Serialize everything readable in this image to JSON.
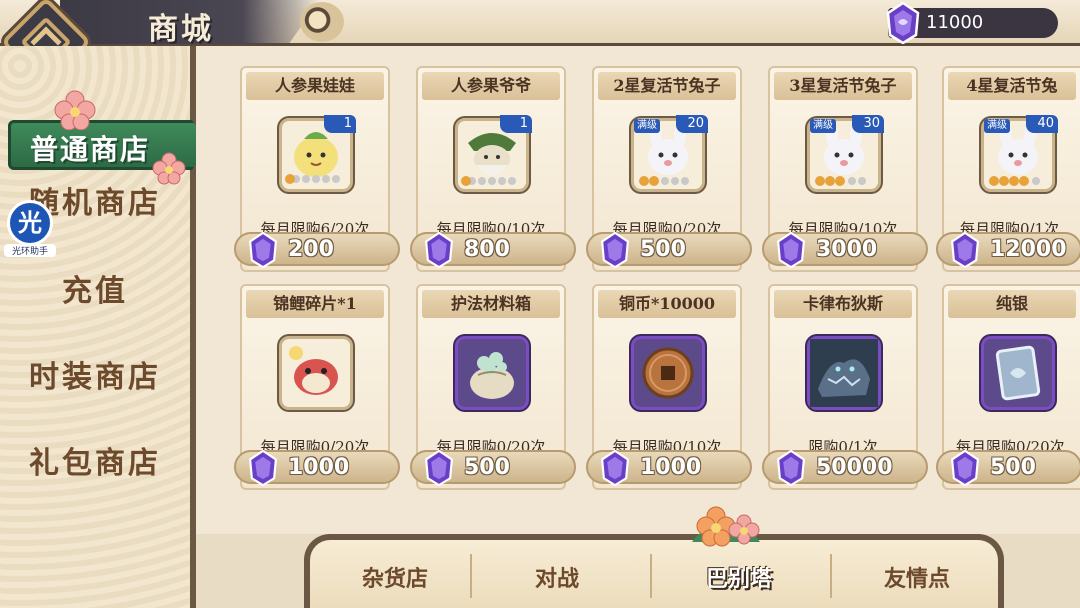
{
  "header": {
    "title": "商城",
    "currency": {
      "icon": "purple-gem-icon",
      "amount": "11000"
    }
  },
  "sidebar": {
    "active": "普通商店",
    "items": [
      "随机商店",
      "充值",
      "时装商店",
      "礼包商店"
    ]
  },
  "overlay_badge": {
    "glyph": "光",
    "caption": "光环助手"
  },
  "shop_items": [
    {
      "name": "人参果娃娃",
      "icon": "ginseng-doll-icon",
      "level": "1",
      "max": false,
      "limit": "每月限购6/20次",
      "price": "200"
    },
    {
      "name": "人参果爷爷",
      "icon": "ginseng-grandpa-icon",
      "level": "1",
      "max": false,
      "limit": "每月限购0/10次",
      "price": "800"
    },
    {
      "name": "2星复活节兔子",
      "icon": "easter-bunny-icon",
      "level": "20",
      "max": true,
      "max_label": "满级",
      "limit": "每月限购0/20次",
      "price": "500"
    },
    {
      "name": "3星复活节兔子",
      "icon": "easter-bunny-icon",
      "level": "30",
      "max": true,
      "max_label": "满级",
      "limit": "每月限购9/10次",
      "price": "3000"
    },
    {
      "name": "4星复活节兔",
      "icon": "easter-bunny-icon",
      "level": "40",
      "max": true,
      "max_label": "满级",
      "limit": "每月限购0/1次",
      "price": "12000"
    },
    {
      "name": "锦鲤碎片*1",
      "icon": "koi-fragment-icon",
      "limit": "每月限购0/20次",
      "price": "1000"
    },
    {
      "name": "护法材料箱",
      "icon": "material-sack-icon",
      "limit": "每月限购0/20次",
      "price": "500"
    },
    {
      "name": "铜币*10000",
      "icon": "copper-coin-icon",
      "limit": "每月限购0/10次",
      "price": "1000"
    },
    {
      "name": "卡律布狄斯",
      "icon": "charybdis-beast-icon",
      "limit": "限购0/1次",
      "price": "50000"
    },
    {
      "name": "纯银",
      "icon": "silver-ingot-icon",
      "limit": "每月限购0/20次",
      "price": "500"
    }
  ],
  "tabs": [
    {
      "label": "杂货店",
      "active": false
    },
    {
      "label": "对战",
      "active": false
    },
    {
      "label": "巴别塔",
      "active": true
    },
    {
      "label": "友情点",
      "active": false
    }
  ],
  "colors": {
    "accent_green": "#2d6a45",
    "gem_purple": "#6a3fc8",
    "frame_dark": "#6a5744"
  }
}
